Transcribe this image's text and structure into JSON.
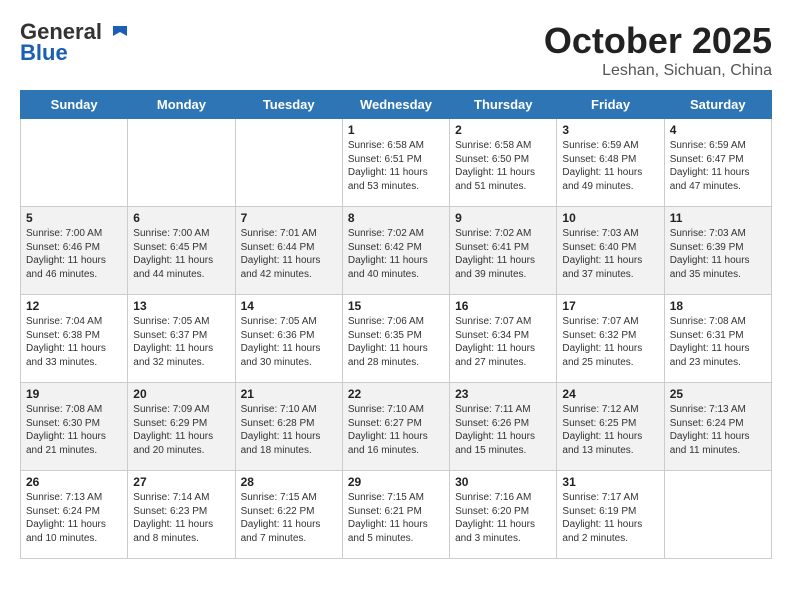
{
  "header": {
    "logo_line1": "General",
    "logo_line2": "Blue",
    "month": "October 2025",
    "location": "Leshan, Sichuan, China"
  },
  "weekdays": [
    "Sunday",
    "Monday",
    "Tuesday",
    "Wednesday",
    "Thursday",
    "Friday",
    "Saturday"
  ],
  "weeks": [
    [
      {
        "day": "",
        "info": ""
      },
      {
        "day": "",
        "info": ""
      },
      {
        "day": "",
        "info": ""
      },
      {
        "day": "1",
        "info": "Sunrise: 6:58 AM\nSunset: 6:51 PM\nDaylight: 11 hours and 53 minutes."
      },
      {
        "day": "2",
        "info": "Sunrise: 6:58 AM\nSunset: 6:50 PM\nDaylight: 11 hours and 51 minutes."
      },
      {
        "day": "3",
        "info": "Sunrise: 6:59 AM\nSunset: 6:48 PM\nDaylight: 11 hours and 49 minutes."
      },
      {
        "day": "4",
        "info": "Sunrise: 6:59 AM\nSunset: 6:47 PM\nDaylight: 11 hours and 47 minutes."
      }
    ],
    [
      {
        "day": "5",
        "info": "Sunrise: 7:00 AM\nSunset: 6:46 PM\nDaylight: 11 hours and 46 minutes."
      },
      {
        "day": "6",
        "info": "Sunrise: 7:00 AM\nSunset: 6:45 PM\nDaylight: 11 hours and 44 minutes."
      },
      {
        "day": "7",
        "info": "Sunrise: 7:01 AM\nSunset: 6:44 PM\nDaylight: 11 hours and 42 minutes."
      },
      {
        "day": "8",
        "info": "Sunrise: 7:02 AM\nSunset: 6:42 PM\nDaylight: 11 hours and 40 minutes."
      },
      {
        "day": "9",
        "info": "Sunrise: 7:02 AM\nSunset: 6:41 PM\nDaylight: 11 hours and 39 minutes."
      },
      {
        "day": "10",
        "info": "Sunrise: 7:03 AM\nSunset: 6:40 PM\nDaylight: 11 hours and 37 minutes."
      },
      {
        "day": "11",
        "info": "Sunrise: 7:03 AM\nSunset: 6:39 PM\nDaylight: 11 hours and 35 minutes."
      }
    ],
    [
      {
        "day": "12",
        "info": "Sunrise: 7:04 AM\nSunset: 6:38 PM\nDaylight: 11 hours and 33 minutes."
      },
      {
        "day": "13",
        "info": "Sunrise: 7:05 AM\nSunset: 6:37 PM\nDaylight: 11 hours and 32 minutes."
      },
      {
        "day": "14",
        "info": "Sunrise: 7:05 AM\nSunset: 6:36 PM\nDaylight: 11 hours and 30 minutes."
      },
      {
        "day": "15",
        "info": "Sunrise: 7:06 AM\nSunset: 6:35 PM\nDaylight: 11 hours and 28 minutes."
      },
      {
        "day": "16",
        "info": "Sunrise: 7:07 AM\nSunset: 6:34 PM\nDaylight: 11 hours and 27 minutes."
      },
      {
        "day": "17",
        "info": "Sunrise: 7:07 AM\nSunset: 6:32 PM\nDaylight: 11 hours and 25 minutes."
      },
      {
        "day": "18",
        "info": "Sunrise: 7:08 AM\nSunset: 6:31 PM\nDaylight: 11 hours and 23 minutes."
      }
    ],
    [
      {
        "day": "19",
        "info": "Sunrise: 7:08 AM\nSunset: 6:30 PM\nDaylight: 11 hours and 21 minutes."
      },
      {
        "day": "20",
        "info": "Sunrise: 7:09 AM\nSunset: 6:29 PM\nDaylight: 11 hours and 20 minutes."
      },
      {
        "day": "21",
        "info": "Sunrise: 7:10 AM\nSunset: 6:28 PM\nDaylight: 11 hours and 18 minutes."
      },
      {
        "day": "22",
        "info": "Sunrise: 7:10 AM\nSunset: 6:27 PM\nDaylight: 11 hours and 16 minutes."
      },
      {
        "day": "23",
        "info": "Sunrise: 7:11 AM\nSunset: 6:26 PM\nDaylight: 11 hours and 15 minutes."
      },
      {
        "day": "24",
        "info": "Sunrise: 7:12 AM\nSunset: 6:25 PM\nDaylight: 11 hours and 13 minutes."
      },
      {
        "day": "25",
        "info": "Sunrise: 7:13 AM\nSunset: 6:24 PM\nDaylight: 11 hours and 11 minutes."
      }
    ],
    [
      {
        "day": "26",
        "info": "Sunrise: 7:13 AM\nSunset: 6:24 PM\nDaylight: 11 hours and 10 minutes."
      },
      {
        "day": "27",
        "info": "Sunrise: 7:14 AM\nSunset: 6:23 PM\nDaylight: 11 hours and 8 minutes."
      },
      {
        "day": "28",
        "info": "Sunrise: 7:15 AM\nSunset: 6:22 PM\nDaylight: 11 hours and 7 minutes."
      },
      {
        "day": "29",
        "info": "Sunrise: 7:15 AM\nSunset: 6:21 PM\nDaylight: 11 hours and 5 minutes."
      },
      {
        "day": "30",
        "info": "Sunrise: 7:16 AM\nSunset: 6:20 PM\nDaylight: 11 hours and 3 minutes."
      },
      {
        "day": "31",
        "info": "Sunrise: 7:17 AM\nSunset: 6:19 PM\nDaylight: 11 hours and 2 minutes."
      },
      {
        "day": "",
        "info": ""
      }
    ]
  ]
}
